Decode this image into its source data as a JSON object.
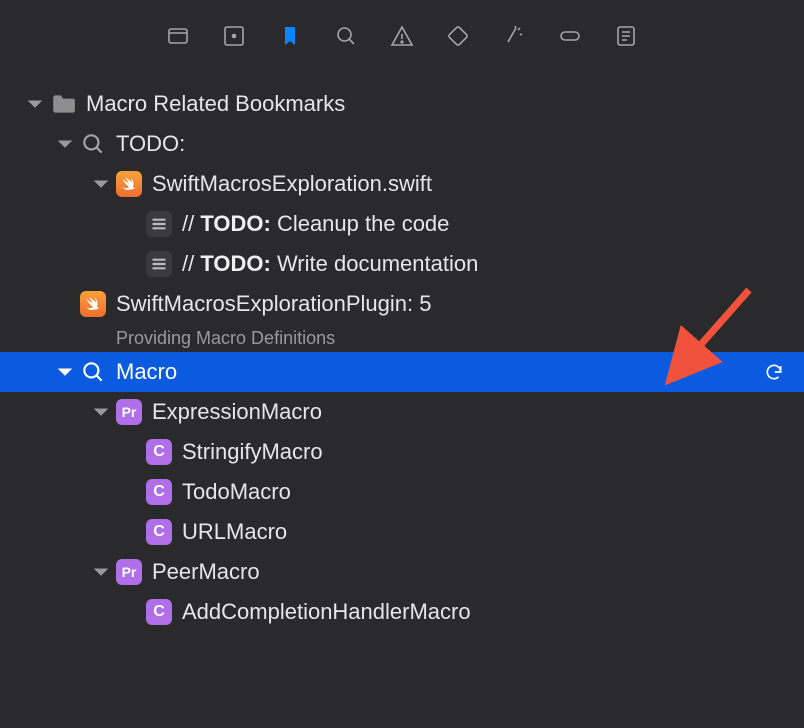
{
  "toolbar": {
    "icons": [
      "files",
      "focus",
      "bookmarks",
      "search",
      "warnings",
      "tags",
      "effects",
      "battery",
      "outline"
    ],
    "active": "bookmarks"
  },
  "root": {
    "title": "Macro Related Bookmarks",
    "children": [
      {
        "icon": "magnifier",
        "label": "TODO:",
        "children": [
          {
            "icon": "swift",
            "label": "SwiftMacrosExploration.swift",
            "children": [
              {
                "icon": "lines",
                "prefix": "// ",
                "bold": "TODO:",
                "rest": " Cleanup the code"
              },
              {
                "icon": "lines",
                "prefix": "// ",
                "bold": "TODO:",
                "rest": " Write documentation"
              }
            ]
          }
        ]
      },
      {
        "icon": "swift",
        "label": "SwiftMacrosExplorationPlugin: 5",
        "subtitle": "Providing Macro Definitions"
      },
      {
        "icon": "magnifier",
        "label": "Macro",
        "selected": true,
        "refresh": true,
        "children": [
          {
            "icon": "pr",
            "label": "ExpressionMacro",
            "children": [
              {
                "icon": "c",
                "label": "StringifyMacro"
              },
              {
                "icon": "c",
                "label": "TodoMacro"
              },
              {
                "icon": "c",
                "label": "URLMacro"
              }
            ]
          },
          {
            "icon": "pr",
            "label": "PeerMacro",
            "children": [
              {
                "icon": "c",
                "label": "AddCompletionHandlerMacro"
              }
            ]
          }
        ]
      }
    ]
  }
}
